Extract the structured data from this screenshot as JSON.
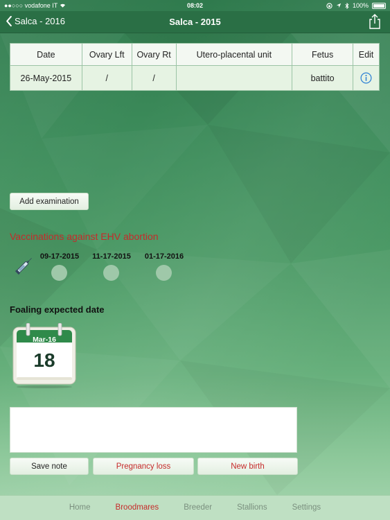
{
  "status": {
    "carrier": "●●○○○ vodafone IT",
    "time": "08:02",
    "battery": "100%"
  },
  "nav": {
    "back_label": "Salca - 2016",
    "title": "Salca - 2015"
  },
  "table": {
    "headers": [
      "Date",
      "Ovary Lft",
      "Ovary Rt",
      "Utero-placental unit",
      "Fetus",
      "Edit"
    ],
    "rows": [
      {
        "date": "26-May-2015",
        "ovary_lft": "/",
        "ovary_rt": "/",
        "utero_placental": "",
        "fetus": "battito"
      }
    ]
  },
  "add_examination_label": "Add examination",
  "vaccinations": {
    "title": "Vaccinations against EHV abortion",
    "dates": [
      "09-17-2015",
      "11-17-2015",
      "01-17-2016"
    ]
  },
  "foaling": {
    "title": "Foaling expected date",
    "month": "Mar-16",
    "day": "18"
  },
  "note": {
    "value": "",
    "placeholder": ""
  },
  "buttons": {
    "save_note": "Save note",
    "pregnancy_loss": "Pregnancy loss",
    "new_birth": "New birth"
  },
  "tabs": [
    {
      "label": "Home",
      "active": false
    },
    {
      "label": "Broodmares",
      "active": true
    },
    {
      "label": "Breeder",
      "active": false
    },
    {
      "label": "Stallions",
      "active": false
    },
    {
      "label": "Settings",
      "active": false
    }
  ],
  "colors": {
    "accent_red": "#c62a2a",
    "nav_green": "#2a6f45",
    "calendar_green": "#2f8a4a"
  }
}
